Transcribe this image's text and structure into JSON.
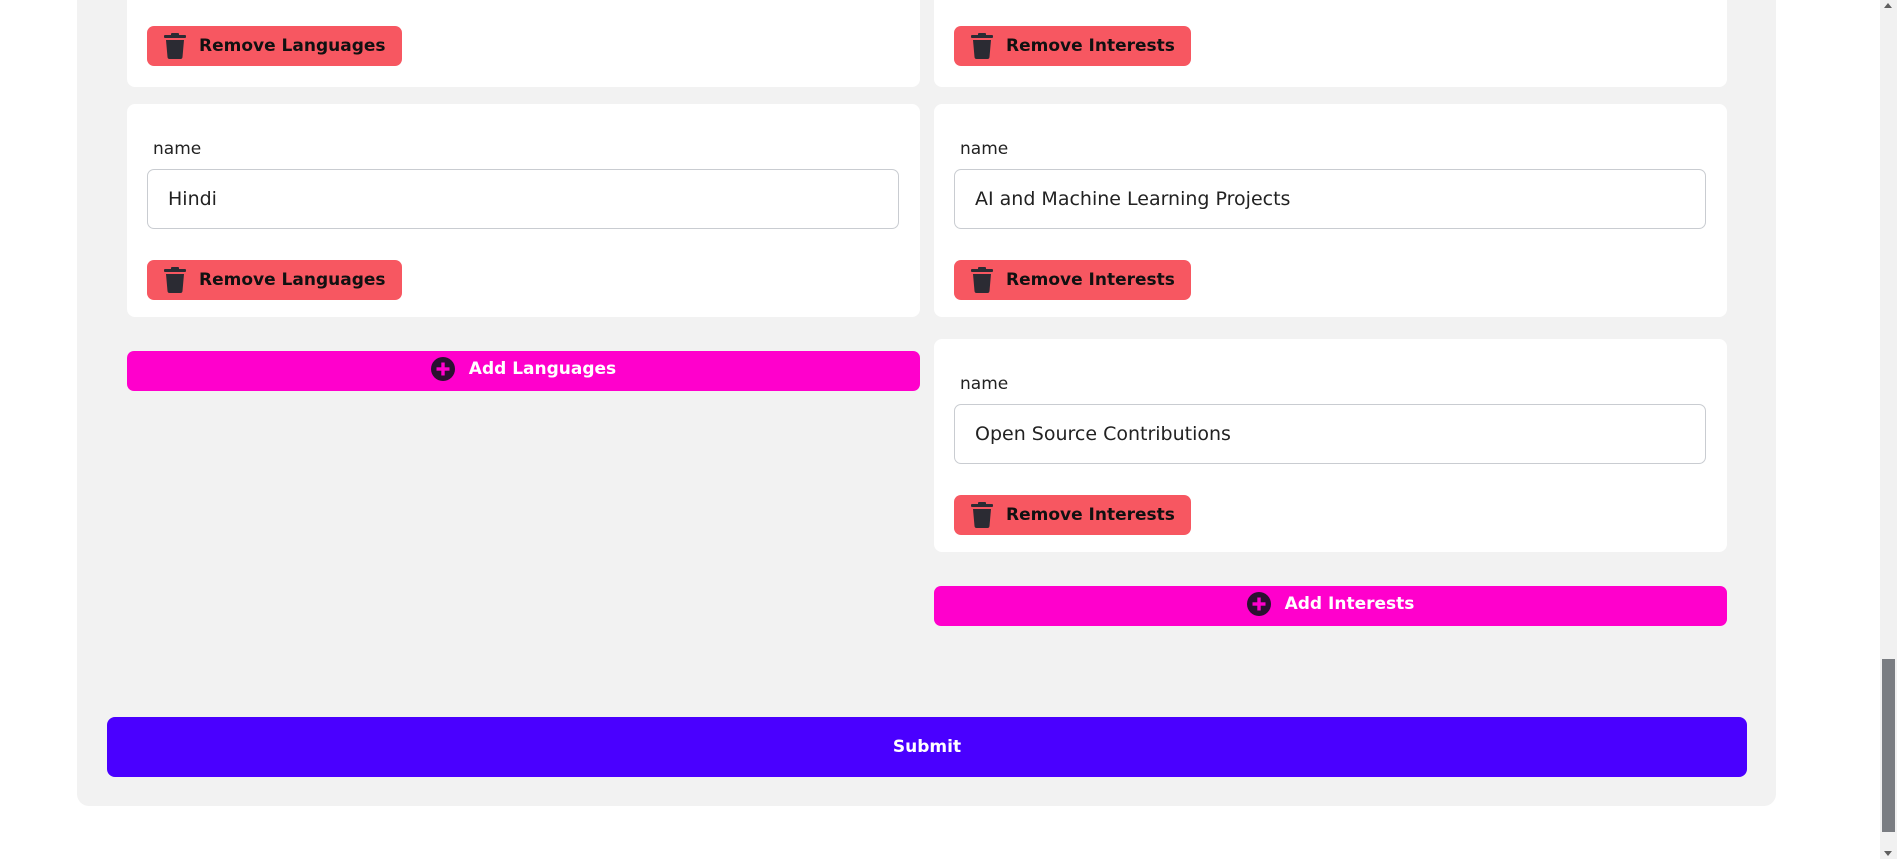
{
  "languages": {
    "items": [
      {
        "label": "name",
        "value": ""
      },
      {
        "label": "name",
        "value": "Hindi"
      }
    ],
    "remove_label": "Remove Languages",
    "add_label": "Add Languages"
  },
  "interests": {
    "items": [
      {
        "label": "name",
        "value": ""
      },
      {
        "label": "name",
        "value": "AI and Machine Learning Projects"
      },
      {
        "label": "name",
        "value": "Open Source Contributions"
      }
    ],
    "remove_label": "Remove Interests",
    "add_label": "Add Interests"
  },
  "submit_label": "Submit",
  "colors": {
    "panel_bg": "#f2f2f2",
    "remove_button": "#f75761",
    "add_button": "#ff00cc",
    "submit_button": "#4a00ff"
  },
  "icons": {
    "remove": "trash-icon",
    "add": "plus-circle-icon"
  }
}
